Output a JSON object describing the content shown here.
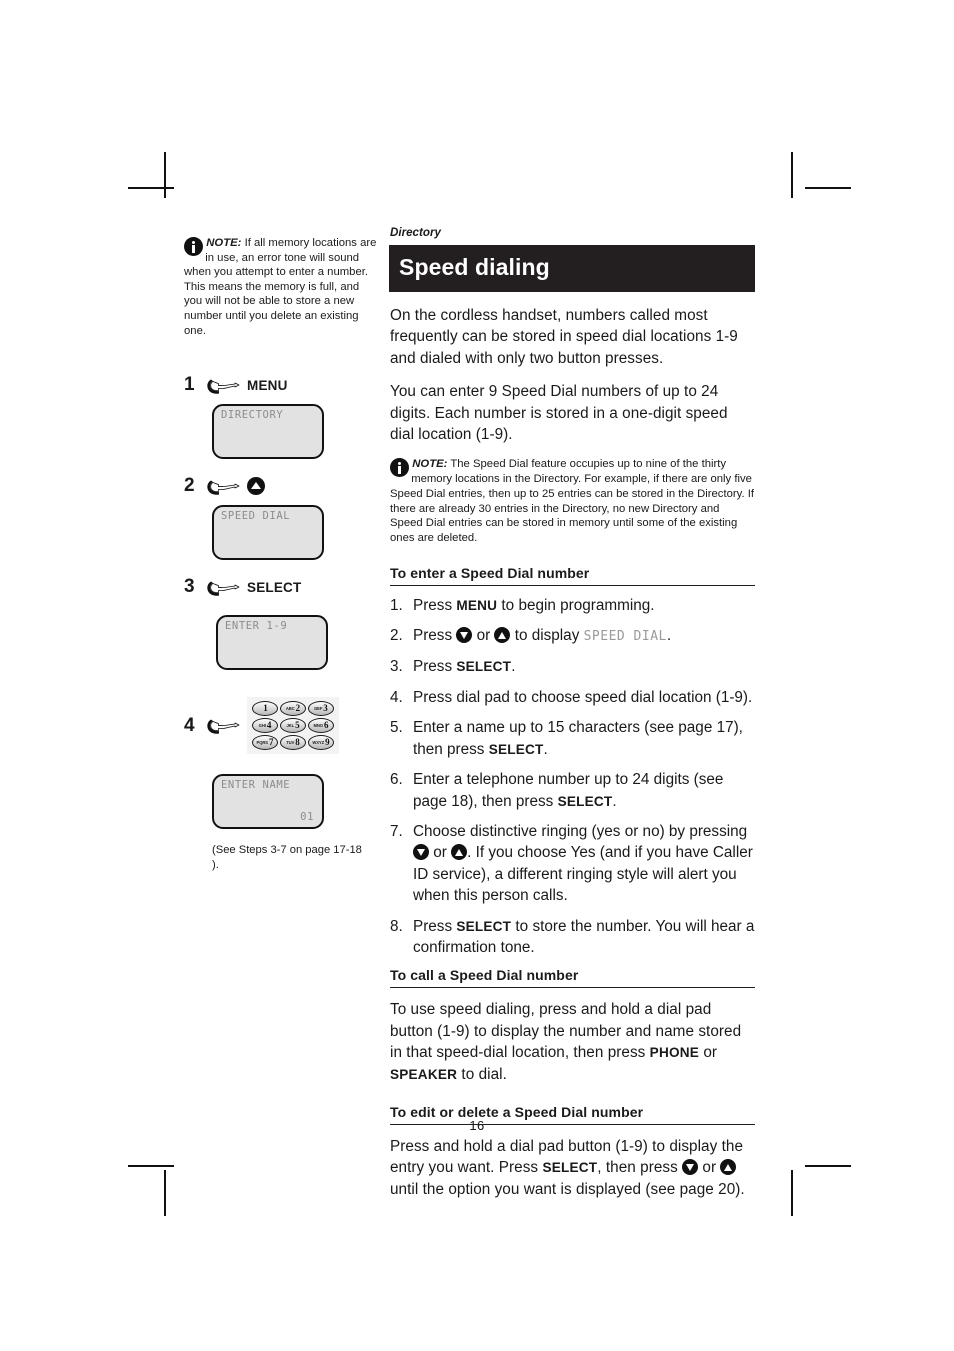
{
  "document": {
    "page_number": "16",
    "eyebrow": "Directory",
    "section_title": "Speed dialing"
  },
  "left_column": {
    "note": {
      "icon": "info-icon",
      "label": "NOTE:",
      "text": "If all memory locations are in use, an error tone will sound when you attempt to enter a number. This means the memory is full, and you will not be able to store a new number until you delete an existing one."
    },
    "steps": [
      {
        "num": "1",
        "icon": "pointing-hand-icon",
        "label": "MENU"
      },
      {
        "num": "2",
        "icon": "pointing-hand-icon",
        "label": "",
        "key_icon": "up-arrow-key-icon"
      },
      {
        "num": "3",
        "icon": "pointing-hand-icon",
        "label": "SELECT"
      },
      {
        "num": "4",
        "icon": "pointing-hand-icon",
        "label": "",
        "keypad": true
      }
    ],
    "lcd_screens": [
      {
        "name": "lcd-directory",
        "line1": "DIRECTORY",
        "line2": ""
      },
      {
        "name": "lcd-speed-dial",
        "line1": "SPEED DIAL",
        "line2": ""
      },
      {
        "name": "lcd-enter-1-9",
        "line1": "ENTER 1-9",
        "line2": ""
      },
      {
        "name": "lcd-enter-name",
        "line1": "ENTER NAME",
        "line2": "01"
      }
    ],
    "keypad": [
      {
        "digit": "1",
        "letters": ""
      },
      {
        "digit": "2",
        "letters": "ABC"
      },
      {
        "digit": "3",
        "letters": "DEF"
      },
      {
        "digit": "4",
        "letters": "GHI"
      },
      {
        "digit": "5",
        "letters": "JKL"
      },
      {
        "digit": "6",
        "letters": "MNO"
      },
      {
        "digit": "7",
        "letters": "PQRS"
      },
      {
        "digit": "8",
        "letters": "TUV"
      },
      {
        "digit": "9",
        "letters": "WXYZ"
      }
    ],
    "caption": "(See Steps 3-7 on page 17-18 )."
  },
  "right_column": {
    "intro_para_1": "On the cordless handset, numbers called most frequently can be stored in speed dial locations 1-9 and dialed with only two button presses.",
    "intro_para_2": "You can enter 9 Speed Dial numbers of up to 24 digits. Each number is stored in a one-digit speed dial location (1-9).",
    "note": {
      "icon": "info-icon",
      "label": "NOTE:",
      "text": "The Speed Dial feature occupies up to nine of the thirty memory locations in the Directory. For example, if there are only five Speed Dial entries, then up to 25 entries can be stored in the Directory. If there are already 30 entries in the Directory, no new Directory and Speed Dial entries can be stored in memory until some of the existing ones are deleted."
    },
    "section_enter": {
      "heading": "To enter a Speed Dial number",
      "steps": [
        {
          "idx": "1.",
          "pre": "Press ",
          "kw": "MENU",
          "post": " to begin programming."
        },
        {
          "idx": "2.",
          "pre": "Press ",
          "kw": "",
          "post": "",
          "special": "arrows-display",
          "mid_text_1": " or ",
          "mid_text_2": " to display ",
          "lcd": "SPEED DIAL",
          "tail": "."
        },
        {
          "idx": "3.",
          "pre": "Press ",
          "kw": "SELECT",
          "post": "."
        },
        {
          "idx": "4.",
          "pre": "Press dial pad to choose speed dial location (1-9).",
          "kw": "",
          "post": ""
        },
        {
          "idx": "5.",
          "pre": "Enter a name up to 15 characters (see page 17), then press ",
          "kw": "SELECT",
          "post": "."
        },
        {
          "idx": "6.",
          "pre": "Enter a telephone number up to 24 digits (see page 18), then press ",
          "kw": "SELECT",
          "post": "."
        },
        {
          "idx": "7.",
          "pre": "Choose distinctive ringing (yes or no) by pressing ",
          "kw": "",
          "post": "",
          "special": "ringing",
          "mid_text_1": " or ",
          "tail": ". If you choose Yes (and if you have Caller ID service), a different ringing style will alert you when this person calls."
        },
        {
          "idx": "8.",
          "pre": "Press ",
          "kw": "SELECT",
          "post": " to store the number. You will hear a confirmation tone."
        }
      ]
    },
    "section_call": {
      "heading": "To call a Speed Dial number",
      "pre": "To use speed dialing, press and hold a dial pad button (1-9) to display the number and name stored in that speed-dial location, then press ",
      "kw1": "PHONE",
      "mid": " or ",
      "kw2": "SPEAKER",
      "post": " to dial."
    },
    "section_edit": {
      "heading": "To edit or delete a Speed Dial number",
      "pre": "Press and hold a dial pad button (1-9) to display the entry you want. Press ",
      "kw1": "SELECT",
      "mid": ", then press ",
      "mid2": " or ",
      "post": " until the option you want is displayed (see page 20)."
    }
  },
  "colors": {
    "title_bar": "#231f20",
    "lcd_background": "#e2e2e2",
    "lcd_text": "#8c8c8c",
    "ink": "#1a1a1a"
  }
}
